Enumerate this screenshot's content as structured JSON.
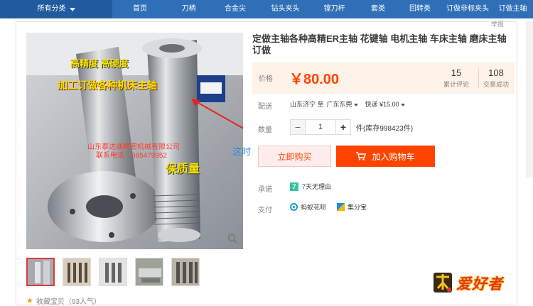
{
  "nav": {
    "items": [
      "所有分类",
      "首页",
      "刀柄",
      "合金尖",
      "钻头夹头",
      "镗刀杆",
      "套类",
      "回转类",
      "订做非标夹头",
      "订做主轴"
    ]
  },
  "report": "举报",
  "product": {
    "title": "定做主轴各种高精ER主轴 花键轴 电机主轴 车床主轴 磨床主轴订做",
    "image_overlays": {
      "line1": "高精度 高硬度",
      "line2": "加工订做各种机床主轴",
      "company": "山东泰达通精密机械有限公司",
      "phone": "联系电话：985479952",
      "quality": "保质量"
    }
  },
  "pricebox": {
    "price_label": "价格",
    "price": "￥80.00",
    "reviews_count": "15",
    "reviews_label": "累计评论",
    "sales_count": "108",
    "sales_label": "交易成功"
  },
  "delivery": {
    "label": "配送",
    "from": "山东济宁 至",
    "to": "广东东莞",
    "method": "快递 ¥15.00"
  },
  "quantity": {
    "label": "数量",
    "value": "1",
    "minus": "−",
    "plus": "+",
    "stock": "件(库存998423件)"
  },
  "annotation": "这时",
  "buttons": {
    "buy_now": "立即购买",
    "add_cart": "加入购物车"
  },
  "promise": {
    "label": "承诺",
    "badge": "7",
    "text": "7天无理由"
  },
  "payment": {
    "label": "支付",
    "methods": [
      "蚂蚁花呗",
      "集分宝"
    ]
  },
  "favorite": "收藏宝贝（93人气）",
  "watermark": "爱好者",
  "colors": {
    "nav": "#2f6fb7",
    "accent": "#ff4400",
    "buy_bg": "#ffeded"
  }
}
